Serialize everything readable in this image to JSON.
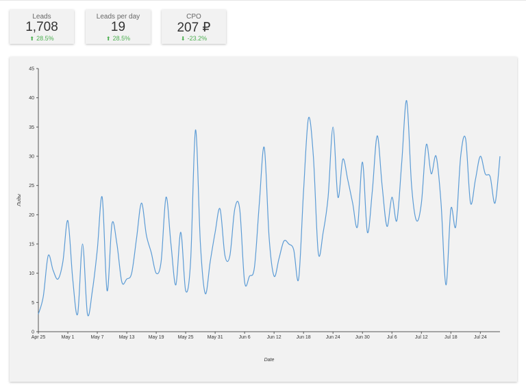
{
  "kpis": [
    {
      "title": "Leads",
      "value": "1,708",
      "change": "28.5%",
      "direction": "up",
      "icon": "arrow-up-icon"
    },
    {
      "title": "Leads per day",
      "value": "19",
      "change": "28.5%",
      "direction": "up",
      "icon": "arrow-up-icon"
    },
    {
      "title": "CPO",
      "value": "207 ₽",
      "change": "-23.2%",
      "direction": "down",
      "icon": "arrow-down-icon"
    }
  ],
  "colors": {
    "positive": "#4caf50",
    "line": "#5b9bd5",
    "card_background": "#f2f2f2"
  },
  "chart_data": {
    "type": "line",
    "title": "",
    "xlabel": "Date",
    "ylabel": "Лиды",
    "ylim": [
      0,
      45
    ],
    "yticks": [
      0,
      5,
      10,
      15,
      20,
      25,
      30,
      35,
      40,
      45
    ],
    "xtick_labels": [
      "Apr 25",
      "May 1",
      "May 7",
      "May 13",
      "May 19",
      "May 25",
      "May 31",
      "Jun 6",
      "Jun 12",
      "Jun 18",
      "Jun 24",
      "Jun 30",
      "Jul 6",
      "Jul 12",
      "Jul 18",
      "Jul 24"
    ],
    "x_start": "Apr 25",
    "series": [
      {
        "values": [
          3,
          6,
          13,
          10.5,
          9,
          12,
          19,
          9,
          3,
          15,
          3,
          7,
          14,
          23,
          7,
          18.5,
          15,
          8.5,
          9,
          10,
          16,
          22,
          16.5,
          13.5,
          10,
          12,
          23,
          15,
          8,
          17,
          7,
          12,
          34.5,
          15,
          6.5,
          12,
          17,
          21,
          13,
          13,
          21,
          21,
          8.5,
          9.5,
          11,
          22,
          31.5,
          16,
          9.5,
          12.5,
          15.5,
          15,
          14,
          9,
          24,
          36.5,
          30,
          13.5,
          17,
          23,
          35,
          23,
          29.5,
          26,
          22,
          18,
          29,
          17,
          24,
          33.5,
          25,
          18,
          23,
          19,
          29,
          39.5,
          25,
          19,
          22,
          32,
          27,
          30,
          22,
          8,
          21,
          18,
          30,
          33,
          22,
          26,
          30,
          27,
          26.5,
          22,
          30
        ]
      }
    ]
  }
}
